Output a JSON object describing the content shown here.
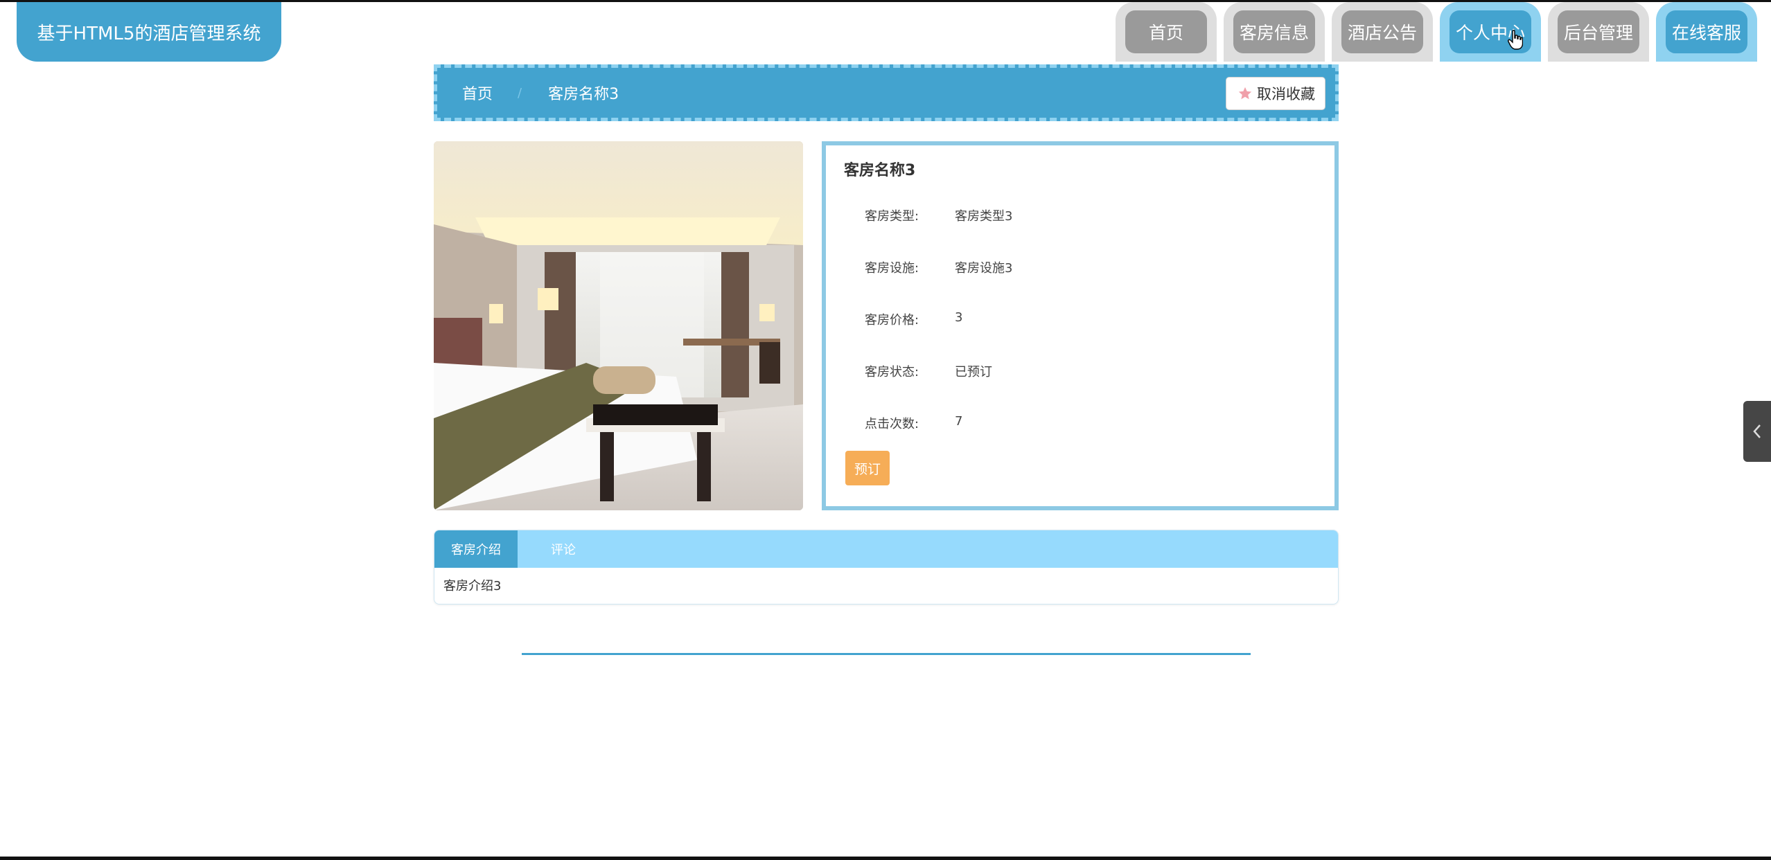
{
  "header": {
    "logo_text": "基于HTML5的酒店管理系统",
    "nav": [
      {
        "label": "首页"
      },
      {
        "label": "客房信息"
      },
      {
        "label": "酒店公告"
      },
      {
        "label": "个人中心"
      },
      {
        "label": "后台管理"
      },
      {
        "label": "在线客服"
      }
    ],
    "active_nav": "个人中心"
  },
  "breadcrumb": {
    "home": "首页",
    "separator": "/",
    "current": "客房名称3",
    "unfavorite_label": "取消收藏"
  },
  "room": {
    "title": "客房名称3",
    "fields": [
      {
        "label": "客房类型:",
        "value": "客房类型3"
      },
      {
        "label": "客房设施:",
        "value": "客房设施3"
      },
      {
        "label": "客房价格:",
        "value": "3"
      },
      {
        "label": "客房状态:",
        "value": "已预订"
      },
      {
        "label": "点击次数:",
        "value": "7"
      }
    ],
    "book_label": "预订"
  },
  "tabs": {
    "items": [
      {
        "label": "客房介绍"
      },
      {
        "label": "评论"
      }
    ],
    "active": "客房介绍",
    "content": "客房介绍3"
  },
  "side_toggle_icon": "chevron-left-icon",
  "colors": {
    "primary": "#43a3cf",
    "light": "#8fd2f0",
    "tab_bar": "#96dafd",
    "book": "#f6ad57",
    "nav_inactive": "#9a9a9a"
  }
}
